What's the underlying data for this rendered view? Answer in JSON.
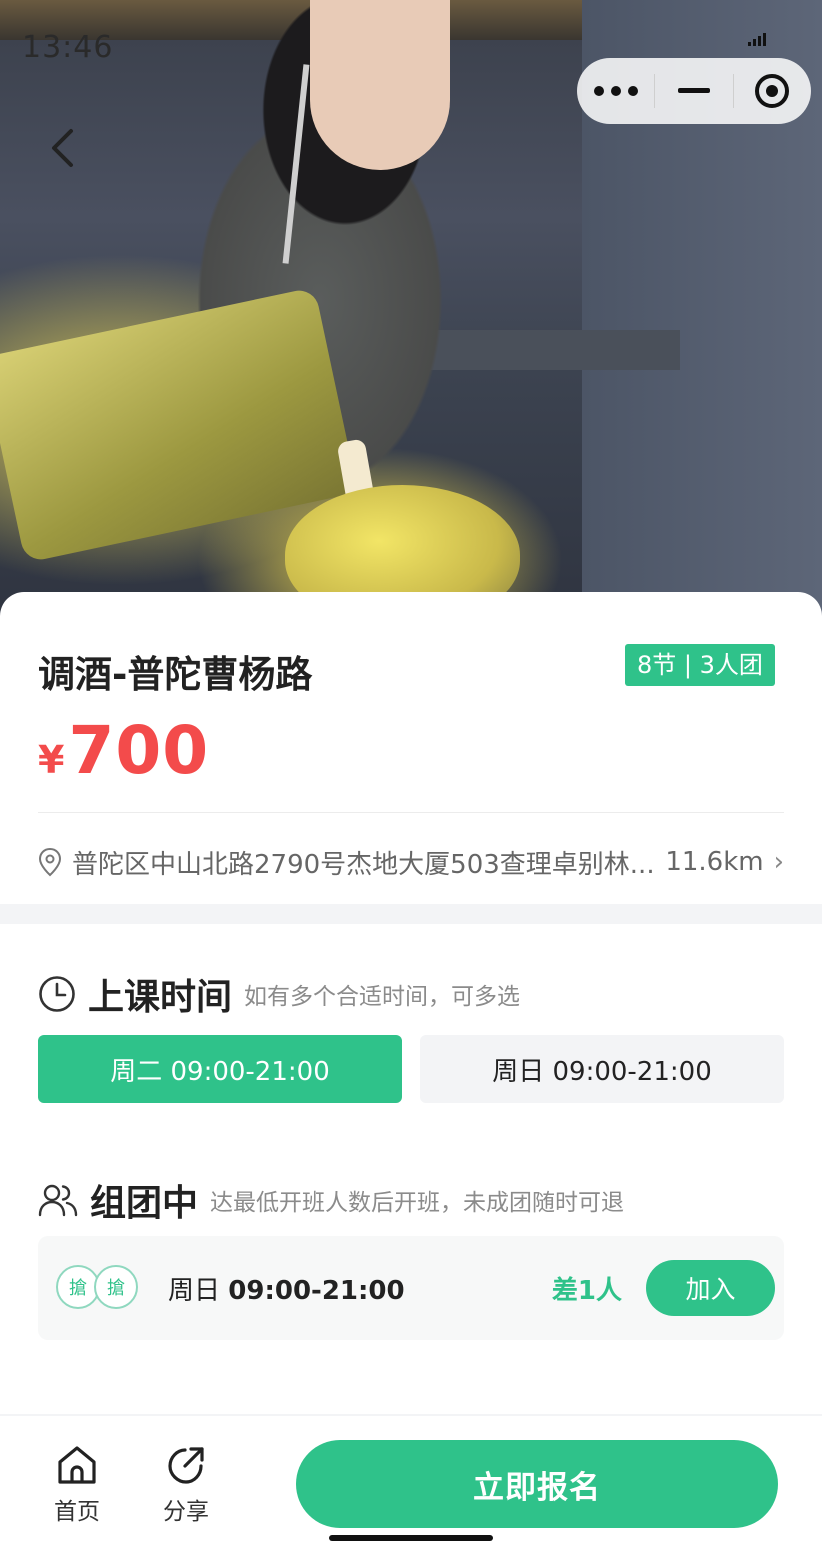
{
  "status_bar": {
    "time": "13:46"
  },
  "hero": {
    "image_alt": "调酒师倒酒照片"
  },
  "course": {
    "title": "调酒-普陀曹杨路",
    "badge": "8节 | 3人团",
    "currency": "¥",
    "price": "700",
    "address": "普陀区中山北路2790号杰地大厦503查理卓别林...",
    "distance": "11.6km",
    "chevron": "›"
  },
  "schedule": {
    "title": "上课时间",
    "subtitle": "如有多个合适时间，可多选",
    "slots": [
      {
        "label": "周二 09:00-21:00",
        "selected": true
      },
      {
        "label": "周日 09:00-21:00",
        "selected": false
      }
    ]
  },
  "group": {
    "title": "组团中",
    "subtitle": "达最低开班人数后开班，未成团随时可退",
    "day": "周日",
    "time": "09:00-21:00",
    "need": "差1人",
    "join_label": "加入",
    "avatar_text": "搶"
  },
  "bottom_bar": {
    "home_label": "首页",
    "share_label": "分享",
    "cta_label": "立即报名"
  },
  "colors": {
    "accent": "#2fc28a",
    "price": "#f34b4b"
  }
}
